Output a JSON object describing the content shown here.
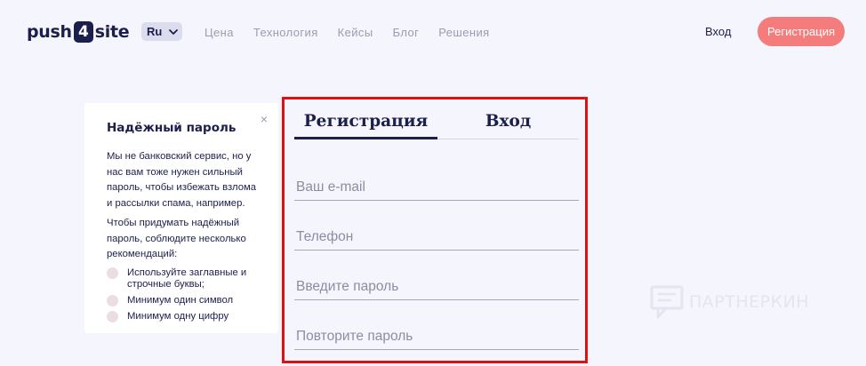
{
  "header": {
    "logo": {
      "left": "push",
      "badge": "4",
      "right": "site"
    },
    "language": "Ru",
    "nav": [
      "Цена",
      "Технология",
      "Кейсы",
      "Блог",
      "Решения"
    ],
    "login": "Вход",
    "register": "Регистрация"
  },
  "hint": {
    "title": "Надёжный пароль",
    "close": "×",
    "paragraphs": [
      "Мы не банковский сервис, но у нас вам тоже нужен сильный пароль, чтобы избежать взлома и рассылки спама, например.",
      "Чтобы придумать надёжный пароль, соблюдите несколько рекомендаций:"
    ],
    "rules": [
      "Используйте заглавные и строчные буквы;",
      "Минимум один символ",
      "Минимум одну цифру"
    ]
  },
  "form": {
    "tabs": [
      {
        "label": "Регистрация",
        "active": true
      },
      {
        "label": "Вход",
        "active": false
      }
    ],
    "fields": {
      "email": {
        "placeholder": "Ваш e-mail",
        "value": ""
      },
      "phone": {
        "placeholder": "Телефон",
        "value": ""
      },
      "password": {
        "placeholder": "Введите пароль",
        "value": ""
      },
      "password_repeat": {
        "placeholder": "Повторите пароль",
        "value": ""
      }
    }
  },
  "watermark": "ПАРТНЕРКИН",
  "colors": {
    "primary": "#1b1f4b",
    "accent": "#f47c7c",
    "highlight_border": "#e01010",
    "background": "#f5f5fd"
  }
}
